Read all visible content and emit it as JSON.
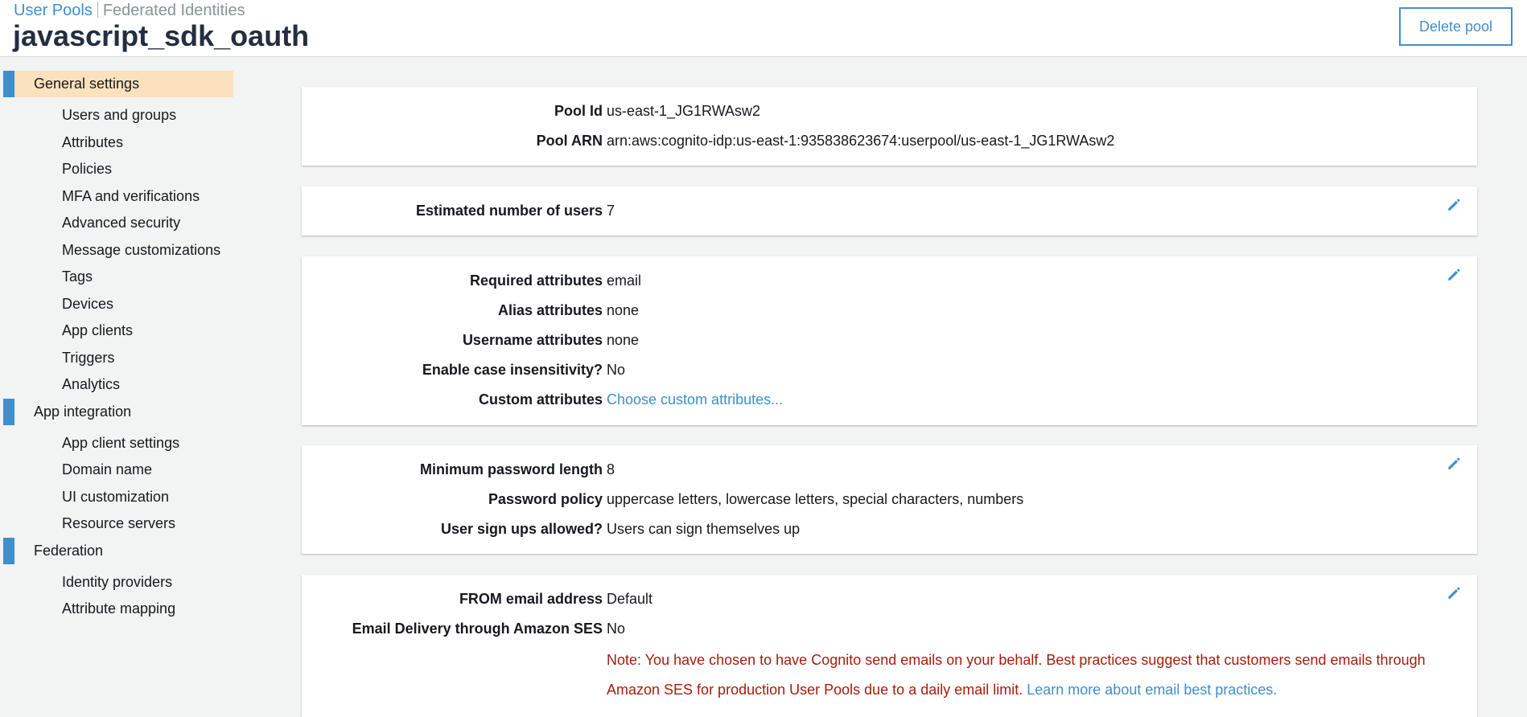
{
  "header": {
    "breadcrumb": {
      "user_pools": "User Pools",
      "federated": "Federated Identities"
    },
    "title": "javascript_sdk_oauth",
    "delete_label": "Delete pool"
  },
  "sidebar": {
    "general": "General settings",
    "general_items": [
      "Users and groups",
      "Attributes",
      "Policies",
      "MFA and verifications",
      "Advanced security",
      "Message customizations",
      "Tags",
      "Devices",
      "App clients",
      "Triggers",
      "Analytics"
    ],
    "app_integration": "App integration",
    "app_items": [
      "App client settings",
      "Domain name",
      "UI customization",
      "Resource servers"
    ],
    "federation": "Federation",
    "federation_items": [
      "Identity providers",
      "Attribute mapping"
    ]
  },
  "pool": {
    "id_label": "Pool Id",
    "id_value": "us-east-1_JG1RWAsw2",
    "arn_label": "Pool ARN",
    "arn_value": "arn:aws:cognito-idp:us-east-1:935838623674:userpool/us-east-1_JG1RWAsw2"
  },
  "users": {
    "label": "Estimated number of users",
    "value": "7"
  },
  "attributes": {
    "required_label": "Required attributes",
    "required_value": "email",
    "alias_label": "Alias attributes",
    "alias_value": "none",
    "username_label": "Username attributes",
    "username_value": "none",
    "case_label": "Enable case insensitivity?",
    "case_value": "No",
    "custom_label": "Custom attributes",
    "custom_link": "Choose custom attributes..."
  },
  "password": {
    "min_label": "Minimum password length",
    "min_value": "8",
    "policy_label": "Password policy",
    "policy_value": "uppercase letters, lowercase letters, special characters, numbers",
    "signup_label": "User sign ups allowed?",
    "signup_value": "Users can sign themselves up"
  },
  "email": {
    "from_label": "FROM email address",
    "from_value": "Default",
    "ses_label": "Email Delivery through Amazon SES",
    "ses_value": "No",
    "note_text": "Note: You have chosen to have Cognito send emails on your behalf. Best practices suggest that customers send emails through Amazon SES for production User Pools due to a daily email limit. ",
    "note_link": "Learn more about email best practices."
  },
  "colors": {
    "link": "#3f8fce",
    "active_bg": "#fbe2bd",
    "warning": "#a71c0c"
  },
  "icons": {
    "edit": "pencil-icon"
  }
}
